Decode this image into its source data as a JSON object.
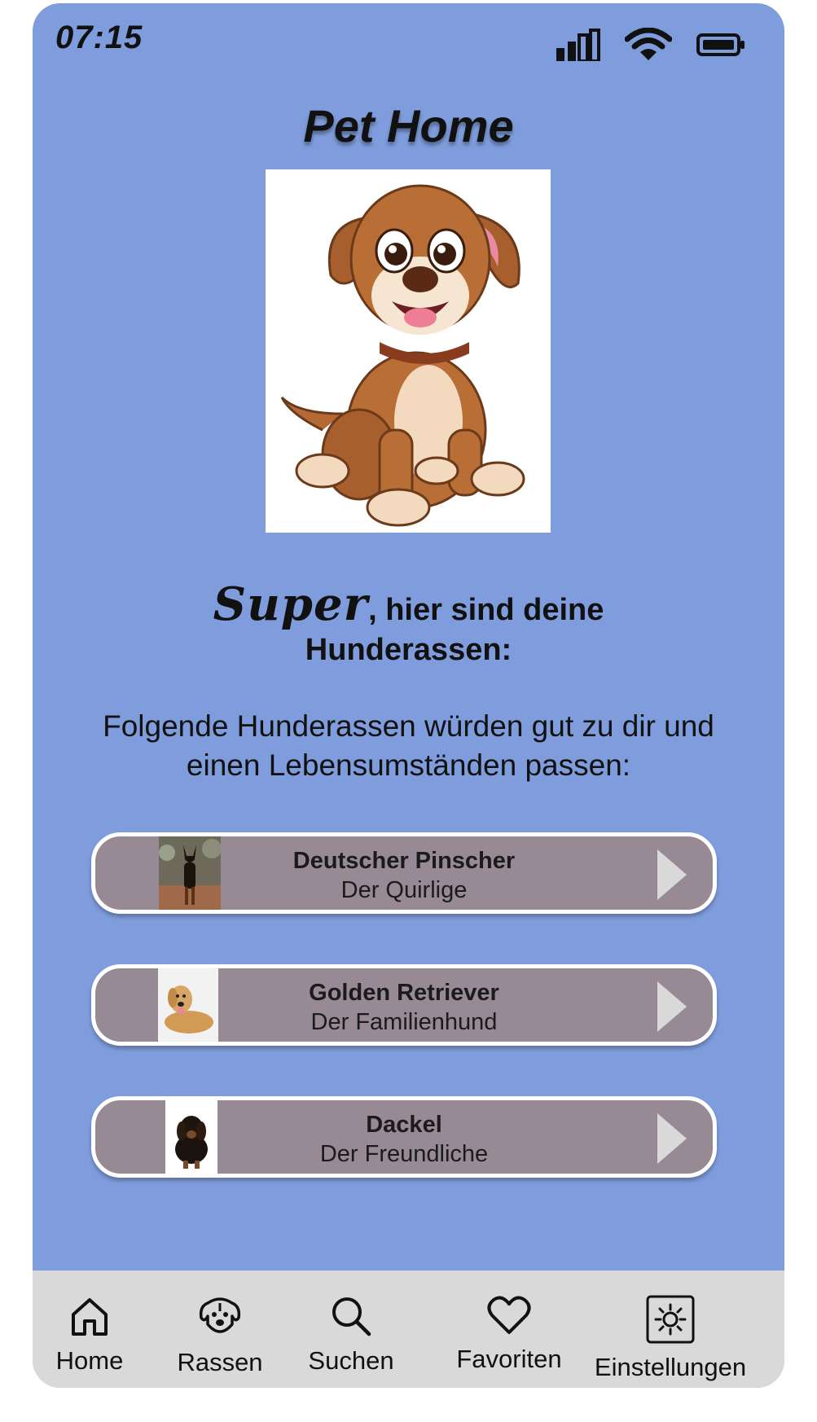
{
  "status": {
    "time": "07:15"
  },
  "app": {
    "title": "Pet Home"
  },
  "headline": {
    "emphasis": "Super",
    "rest": ", hier sind deine",
    "line2": "Hunderassen:"
  },
  "subtitle": "Folgende Hunderassen würden gut zu dir und einen Lebensumständen passen:",
  "breeds": [
    {
      "name": "Deutscher Pinscher",
      "desc": "Der Quirlige"
    },
    {
      "name": "Golden Retriever",
      "desc": "Der Familienhund"
    },
    {
      "name": "Dackel",
      "desc": "Der Freundliche"
    }
  ],
  "tabs": [
    {
      "label": "Home",
      "icon": "home-icon"
    },
    {
      "label": "Rassen",
      "icon": "dog-face-icon"
    },
    {
      "label": "Suchen",
      "icon": "search-icon"
    },
    {
      "label": "Favoriten",
      "icon": "heart-icon"
    },
    {
      "label": "Einstellungen",
      "icon": "gear-icon"
    }
  ],
  "colors": {
    "background": "#7f9ddc",
    "card": "#978a94",
    "tabbar": "#d9d9d9"
  }
}
